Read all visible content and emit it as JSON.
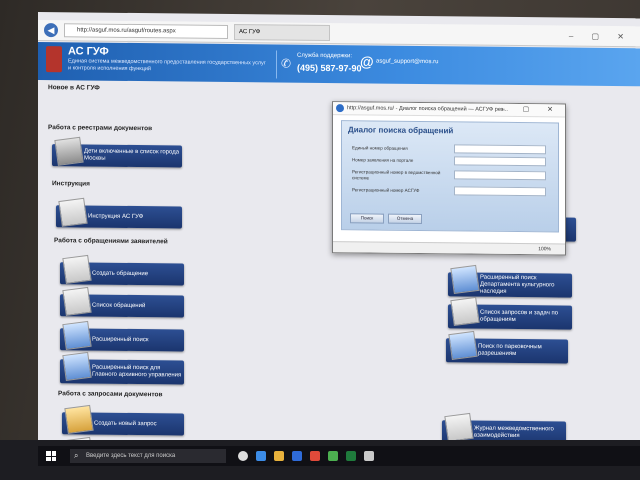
{
  "browser": {
    "url": "http://asguf.mos.ru/asguf/routes.aspx",
    "tab_label": "АС ГУФ"
  },
  "banner": {
    "brand": "АС ГУФ",
    "subtitle": "Единая система межведомственного предоставления государственных услуг и контроля исполнения функций",
    "support_label": "Служба поддержки:",
    "phone": "(495) 587-97-90",
    "email": "asguf_support@mos.ru"
  },
  "sections": {
    "news": "Новое в АС ГУФ",
    "registries": "Работа с реестрами документов",
    "instructions": "Инструкция",
    "applications": "Работа с обращениями заявителей",
    "requests": "Работа с запросами документов"
  },
  "buttons": {
    "children": "Дети включенные в список города Москвы",
    "instruction": "Инструкция АС ГУФ",
    "create": "Создать обращение",
    "list": "Список обращений",
    "ext_search": "Расширенный поиск",
    "ext_search_archive": "Расширенный поиск для Главного архивного управления",
    "create_request": "Создать новый запрос",
    "ext_search_heritage": "Расширенный поиск Департамента культурного наследия",
    "requests_tasks": "Список запросов и задач по обращениям",
    "permits_search": "Поиск по парковочным разрешениям",
    "journal": "Журнал межведомственного взаимодействия"
  },
  "dialog": {
    "window_title": "http://asguf.mos.ru/ - Диалог поиска обращений — АСГУФ рез...",
    "heading": "Диалог поиска обращений",
    "fields": [
      {
        "label": "Единый номер обращения"
      },
      {
        "label": "Номер заявления на портале"
      },
      {
        "label": "Регистрационный номер в ведомственной системе"
      },
      {
        "label": "Регистрационный номер АСГУФ"
      }
    ],
    "search_btn": "Поиск",
    "cancel_btn": "Отмена",
    "zoom": "100%"
  },
  "taskbar": {
    "search_placeholder": "Введите здесь текст для поиска"
  }
}
